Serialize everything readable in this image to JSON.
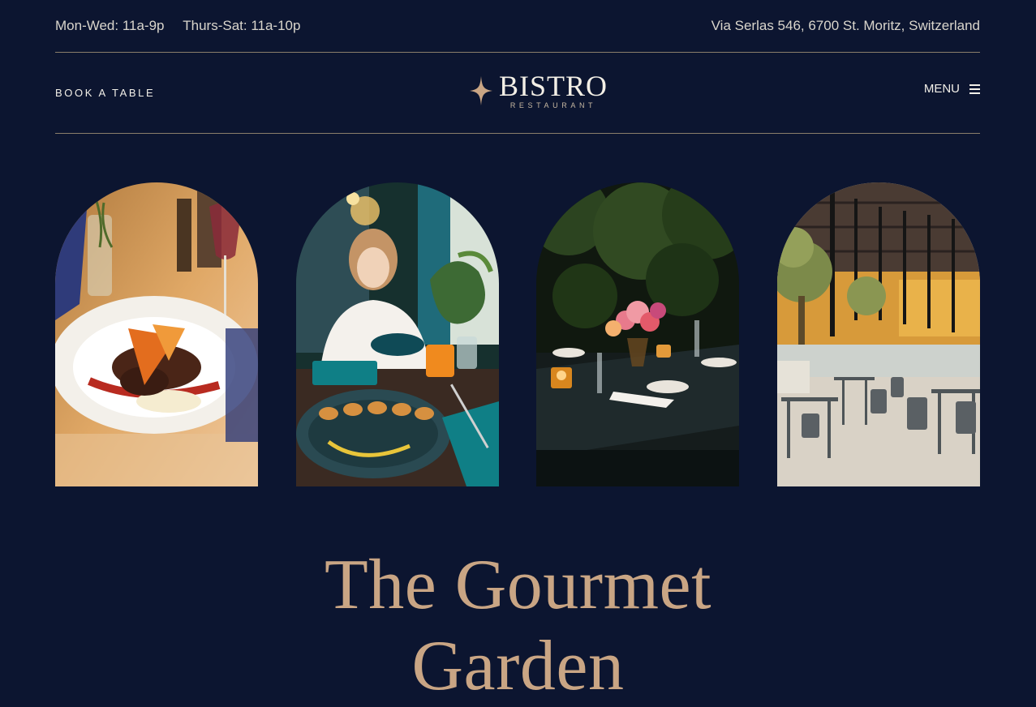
{
  "topbar": {
    "hours_weekday": "Mon-Wed: 11a-9p",
    "hours_weekend": "Thurs-Sat: 11a-10p",
    "address": "Via Serlas 546, 6700 St. Moritz, Switzerland"
  },
  "nav": {
    "book_label": "BOOK A TABLE",
    "logo_word": "BISTRO",
    "logo_sub": "RESTAURANT",
    "menu_label": "MENU",
    "menu_icon": "hamburger-icon",
    "logo_icon": "four-point-star-icon"
  },
  "hero": {
    "title_line1": "The Gourmet",
    "title_line2": "Garden"
  },
  "colors": {
    "background": "#0c1530",
    "accent_gold": "#c9a584",
    "divider": "#8a7d6a",
    "text_light": "#f2efe8"
  }
}
